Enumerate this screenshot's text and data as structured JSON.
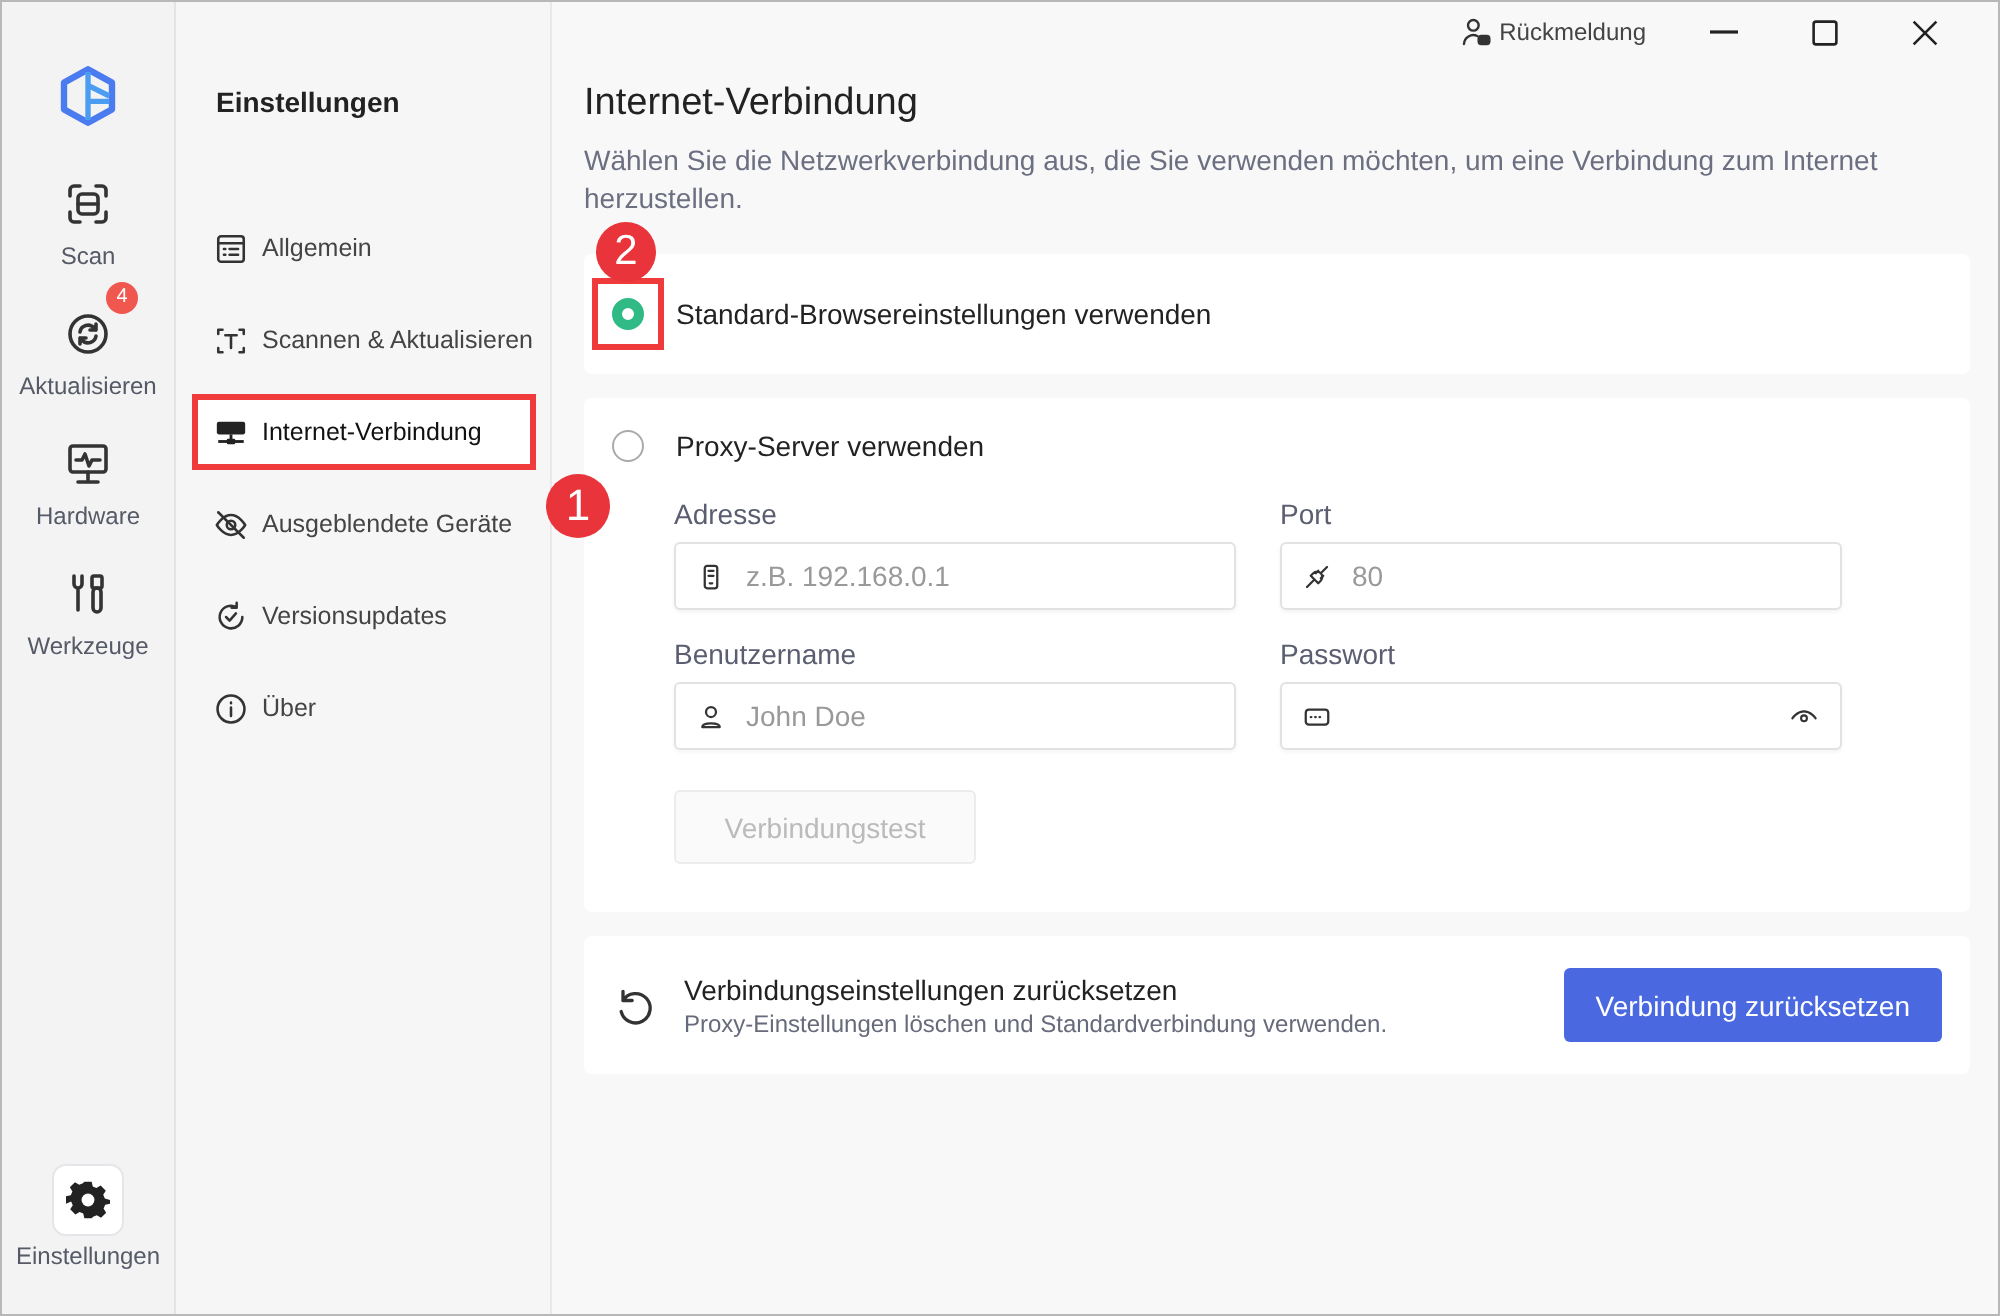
{
  "titlebar": {
    "feedback": "Rückmeldung"
  },
  "rail": {
    "items": [
      {
        "label": "Scan",
        "selected": false
      },
      {
        "label": "Aktualisieren",
        "selected": false,
        "badge": "4"
      },
      {
        "label": "Hardware",
        "selected": false
      },
      {
        "label": "Werkzeuge",
        "selected": false
      }
    ],
    "footer_item": {
      "label": "Einstellungen",
      "selected": true
    }
  },
  "settings_nav": {
    "title": "Einstellungen",
    "items": [
      {
        "label": "Allgemein",
        "selected": false,
        "highlighted": false
      },
      {
        "label": "Scannen & Aktualisieren",
        "selected": false,
        "highlighted": false
      },
      {
        "label": "Internet-Verbindung",
        "selected": true,
        "highlighted": true
      },
      {
        "label": "Ausgeblendete Geräte",
        "selected": false,
        "highlighted": false
      },
      {
        "label": "Versionsupdates",
        "selected": false,
        "highlighted": false
      },
      {
        "label": "Über",
        "selected": false,
        "highlighted": false
      }
    ]
  },
  "page": {
    "title": "Internet-Verbindung",
    "description": "Wählen Sie die Netzwerkverbindung aus, die Sie verwenden möchten, um eine Verbindung zum Internet herzustellen."
  },
  "options": [
    {
      "label": "Standard-Browsereinstellungen verwenden",
      "selected": true,
      "highlighted": true
    },
    {
      "label": "Proxy-Server verwenden",
      "selected": false,
      "highlighted": false
    }
  ],
  "proxy_fields": [
    {
      "kind": "address",
      "label": "Adresse",
      "placeholder": "z.B. 192.168.0.1"
    },
    {
      "kind": "port",
      "label": "Port",
      "placeholder": "80"
    },
    {
      "kind": "user",
      "label": "Benutzername",
      "placeholder": "John Doe"
    },
    {
      "kind": "password",
      "label": "Passwort"
    }
  ],
  "test_button": {
    "label": "Verbindungstest",
    "disabled": true
  },
  "reset": {
    "title": "Verbindungseinstellungen zurücksetzen",
    "subtitle": "Proxy-Einstellungen löschen und Standardverbindung verwenden.",
    "button": "Verbindung zurücksetzen"
  },
  "annotations": [
    {
      "label": "1"
    },
    {
      "label": "2"
    }
  ]
}
